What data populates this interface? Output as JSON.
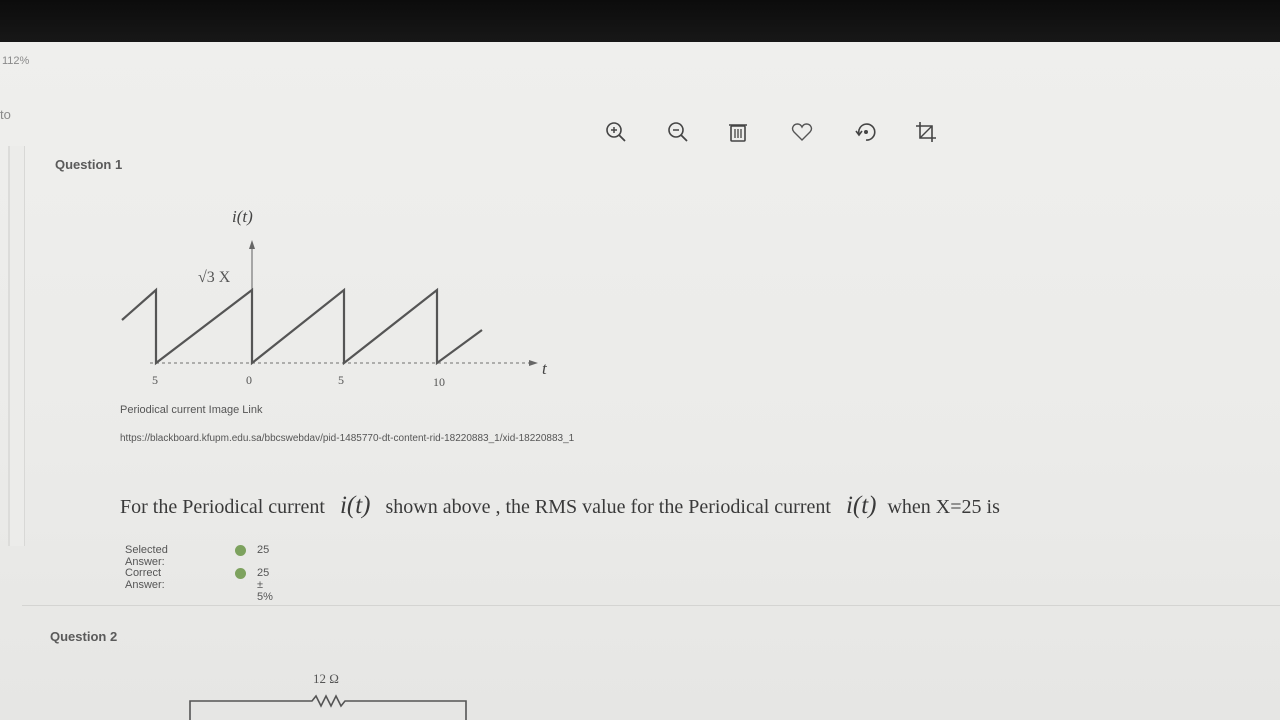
{
  "viewer": {
    "zoom": "112%",
    "left_fragment": "to",
    "tools": [
      {
        "icon": "zoom-in-icon"
      },
      {
        "icon": "zoom-out-icon"
      },
      {
        "icon": "trash-icon"
      },
      {
        "icon": "heart-icon"
      },
      {
        "icon": "rotate-icon"
      },
      {
        "icon": "crop-icon"
      }
    ]
  },
  "question1": {
    "title": "Question 1",
    "figure": {
      "y_label": "i(t)",
      "peak_label": "√3 X",
      "x_label": "t",
      "ticks": [
        "5",
        "0",
        "5",
        "10"
      ]
    },
    "caption": "Periodical current Image Link",
    "url": "https://blackboard.kfupm.edu.sa/bbcswebdav/pid-1485770-dt-content-rid-18220883_1/xid-18220883_1",
    "text_before": "For the Periodical current",
    "math": "i(t)",
    "text_middle": "shown above , the RMS value for the Periodical current",
    "text_after": "when X=25 is",
    "selected_answer_label": "Selected Answer:",
    "selected_answer_value": "25",
    "correct_answer_label": "Correct Answer:",
    "correct_answer_value": "25 ± 5%",
    "check_color": "#7da25e"
  },
  "question2": {
    "title": "Question 2",
    "resistor_label": "12 Ω"
  }
}
